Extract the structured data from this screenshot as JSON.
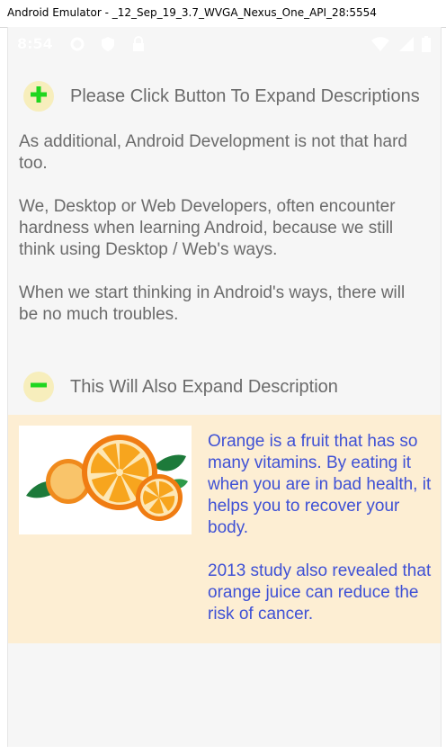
{
  "window": {
    "title": "Android Emulator - _12_Sep_19_3.7_WVGA_Nexus_One_API_28:5554"
  },
  "status_bar": {
    "time": "8:54",
    "icons": [
      "gear-icon",
      "shield-icon",
      "lock-icon",
      "wifi-icon",
      "battery-icon"
    ]
  },
  "sections": [
    {
      "button_icon": "plus",
      "title": "Please Click Button To Expand Descriptions",
      "paragraphs": [
        "As additional, Android Development is not that hard too.",
        "We, Desktop or Web Developers, often encounter hardness when learning Android, because we still think using Desktop / Web's ways.",
        "When we start thinking in Android's ways, there will be no much troubles."
      ]
    },
    {
      "button_icon": "minus",
      "title": "This Will Also Expand Description",
      "image": "orange-fruit-image",
      "paragraphs": [
        "Orange is a fruit that has so many vitamins. By eating it when you are in bad health, it helps you to recover your body.",
        "2013 study also revealed that orange juice can reduce the risk of cancer."
      ]
    }
  ],
  "colors": {
    "button_bg": "#f7eebc",
    "icon_green": "#1fd61f",
    "panel_bg": "#fdeed3",
    "panel_text": "#3f51d5",
    "body_text": "#6b6b6b"
  }
}
